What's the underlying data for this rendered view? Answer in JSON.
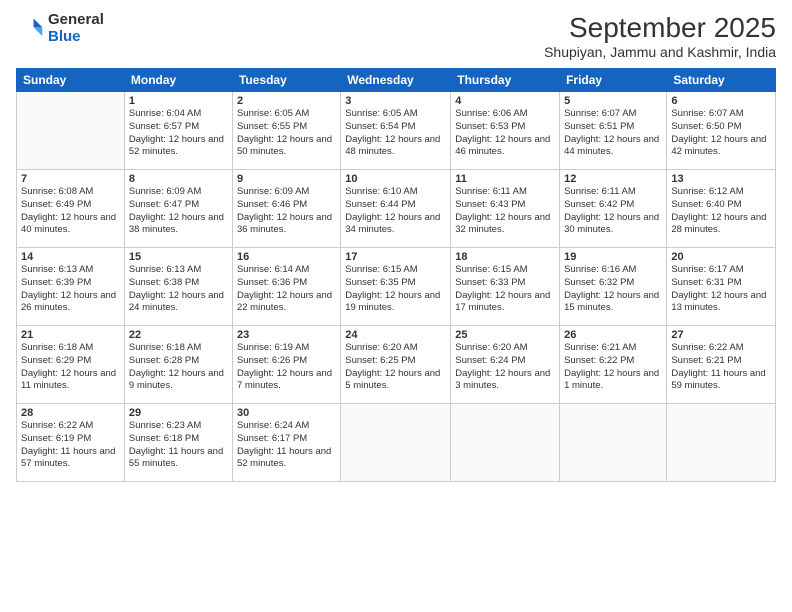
{
  "logo": {
    "general": "General",
    "blue": "Blue"
  },
  "header": {
    "month": "September 2025",
    "location": "Shupiyan, Jammu and Kashmir, India"
  },
  "weekdays": [
    "Sunday",
    "Monday",
    "Tuesday",
    "Wednesday",
    "Thursday",
    "Friday",
    "Saturday"
  ],
  "weeks": [
    [
      {
        "day": "",
        "empty": true
      },
      {
        "day": "1",
        "sunrise": "6:04 AM",
        "sunset": "6:57 PM",
        "daylight": "12 hours and 52 minutes."
      },
      {
        "day": "2",
        "sunrise": "6:05 AM",
        "sunset": "6:55 PM",
        "daylight": "12 hours and 50 minutes."
      },
      {
        "day": "3",
        "sunrise": "6:05 AM",
        "sunset": "6:54 PM",
        "daylight": "12 hours and 48 minutes."
      },
      {
        "day": "4",
        "sunrise": "6:06 AM",
        "sunset": "6:53 PM",
        "daylight": "12 hours and 46 minutes."
      },
      {
        "day": "5",
        "sunrise": "6:07 AM",
        "sunset": "6:51 PM",
        "daylight": "12 hours and 44 minutes."
      },
      {
        "day": "6",
        "sunrise": "6:07 AM",
        "sunset": "6:50 PM",
        "daylight": "12 hours and 42 minutes."
      }
    ],
    [
      {
        "day": "7",
        "sunrise": "6:08 AM",
        "sunset": "6:49 PM",
        "daylight": "12 hours and 40 minutes."
      },
      {
        "day": "8",
        "sunrise": "6:09 AM",
        "sunset": "6:47 PM",
        "daylight": "12 hours and 38 minutes."
      },
      {
        "day": "9",
        "sunrise": "6:09 AM",
        "sunset": "6:46 PM",
        "daylight": "12 hours and 36 minutes."
      },
      {
        "day": "10",
        "sunrise": "6:10 AM",
        "sunset": "6:44 PM",
        "daylight": "12 hours and 34 minutes."
      },
      {
        "day": "11",
        "sunrise": "6:11 AM",
        "sunset": "6:43 PM",
        "daylight": "12 hours and 32 minutes."
      },
      {
        "day": "12",
        "sunrise": "6:11 AM",
        "sunset": "6:42 PM",
        "daylight": "12 hours and 30 minutes."
      },
      {
        "day": "13",
        "sunrise": "6:12 AM",
        "sunset": "6:40 PM",
        "daylight": "12 hours and 28 minutes."
      }
    ],
    [
      {
        "day": "14",
        "sunrise": "6:13 AM",
        "sunset": "6:39 PM",
        "daylight": "12 hours and 26 minutes."
      },
      {
        "day": "15",
        "sunrise": "6:13 AM",
        "sunset": "6:38 PM",
        "daylight": "12 hours and 24 minutes."
      },
      {
        "day": "16",
        "sunrise": "6:14 AM",
        "sunset": "6:36 PM",
        "daylight": "12 hours and 22 minutes."
      },
      {
        "day": "17",
        "sunrise": "6:15 AM",
        "sunset": "6:35 PM",
        "daylight": "12 hours and 19 minutes."
      },
      {
        "day": "18",
        "sunrise": "6:15 AM",
        "sunset": "6:33 PM",
        "daylight": "12 hours and 17 minutes."
      },
      {
        "day": "19",
        "sunrise": "6:16 AM",
        "sunset": "6:32 PM",
        "daylight": "12 hours and 15 minutes."
      },
      {
        "day": "20",
        "sunrise": "6:17 AM",
        "sunset": "6:31 PM",
        "daylight": "12 hours and 13 minutes."
      }
    ],
    [
      {
        "day": "21",
        "sunrise": "6:18 AM",
        "sunset": "6:29 PM",
        "daylight": "12 hours and 11 minutes."
      },
      {
        "day": "22",
        "sunrise": "6:18 AM",
        "sunset": "6:28 PM",
        "daylight": "12 hours and 9 minutes."
      },
      {
        "day": "23",
        "sunrise": "6:19 AM",
        "sunset": "6:26 PM",
        "daylight": "12 hours and 7 minutes."
      },
      {
        "day": "24",
        "sunrise": "6:20 AM",
        "sunset": "6:25 PM",
        "daylight": "12 hours and 5 minutes."
      },
      {
        "day": "25",
        "sunrise": "6:20 AM",
        "sunset": "6:24 PM",
        "daylight": "12 hours and 3 minutes."
      },
      {
        "day": "26",
        "sunrise": "6:21 AM",
        "sunset": "6:22 PM",
        "daylight": "12 hours and 1 minute."
      },
      {
        "day": "27",
        "sunrise": "6:22 AM",
        "sunset": "6:21 PM",
        "daylight": "11 hours and 59 minutes."
      }
    ],
    [
      {
        "day": "28",
        "sunrise": "6:22 AM",
        "sunset": "6:19 PM",
        "daylight": "11 hours and 57 minutes."
      },
      {
        "day": "29",
        "sunrise": "6:23 AM",
        "sunset": "6:18 PM",
        "daylight": "11 hours and 55 minutes."
      },
      {
        "day": "30",
        "sunrise": "6:24 AM",
        "sunset": "6:17 PM",
        "daylight": "11 hours and 52 minutes."
      },
      {
        "day": "",
        "empty": true
      },
      {
        "day": "",
        "empty": true
      },
      {
        "day": "",
        "empty": true
      },
      {
        "day": "",
        "empty": true
      }
    ]
  ]
}
